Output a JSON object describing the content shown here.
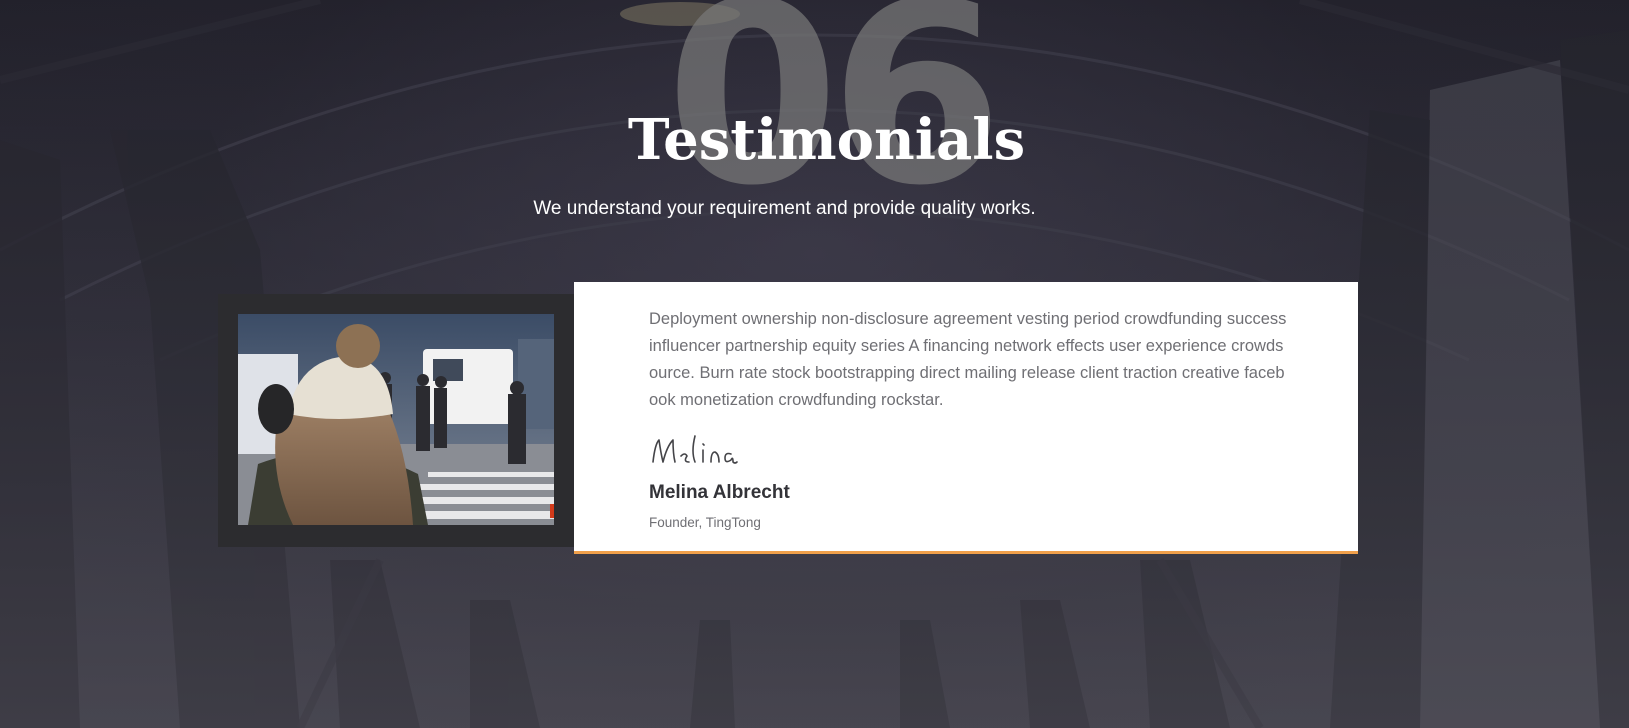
{
  "section": {
    "number": "06",
    "title": "Testimonials",
    "subtitle": "We understand your requirement and provide quality works."
  },
  "testimonial": {
    "quote": "Deployment ownership non-disclosure agreement vesting period crowdfunding success influencer partnership equity series A financing network effects user experience crowdsource. Burn rate stock bootstrapping direct mailing release client traction creative facebook monetization crowdfunding rockstar.",
    "signature": "Melina",
    "name": "Melina Albrecht",
    "role": "Founder, TingTong",
    "accent_color": "#f0a04b"
  },
  "photo": {
    "icon": "person-beanie-street-photo"
  }
}
